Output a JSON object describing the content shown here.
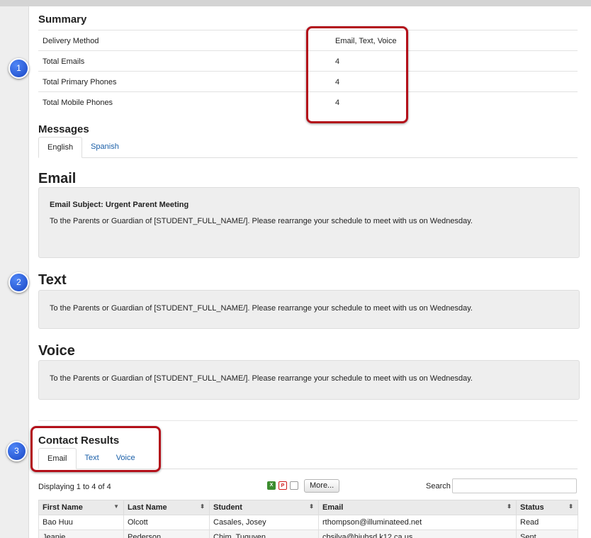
{
  "summary": {
    "title": "Summary",
    "rows": [
      {
        "label": "Delivery Method",
        "value": "Email, Text, Voice"
      },
      {
        "label": "Total Emails",
        "value": "4"
      },
      {
        "label": "Total Primary Phones",
        "value": "4"
      },
      {
        "label": "Total Mobile Phones",
        "value": "4"
      }
    ]
  },
  "messages": {
    "title": "Messages",
    "tabs": [
      "English",
      "Spanish"
    ],
    "email": {
      "heading": "Email",
      "subject": "Email Subject: Urgent Parent Meeting",
      "body": "To the Parents or Guardian of [STUDENT_FULL_NAME/].  Please rearrange your schedule to meet with us on Wednesday."
    },
    "text": {
      "heading": "Text",
      "body": "To the Parents or Guardian of [STUDENT_FULL_NAME/]. Please rearrange your schedule to meet with us on Wednesday."
    },
    "voice": {
      "heading": "Voice",
      "body": "To the Parents or Guardian of [STUDENT_FULL_NAME/]. Please rearrange your schedule to meet with us on Wednesday."
    }
  },
  "contact_results": {
    "title": "Contact Results",
    "tabs": [
      "Email",
      "Text",
      "Voice"
    ],
    "displaying": "Displaying 1 to 4 of 4",
    "more_label": "More...",
    "search_label": "Search",
    "search_value": "",
    "columns": [
      "First Name",
      "Last Name",
      "Student",
      "Email",
      "Status"
    ],
    "rows": [
      [
        "Bao Huu",
        "Olcott",
        "Casales, Josey",
        "rthompson@illuminateed.net",
        "Read"
      ],
      [
        "Jeanie",
        "Pederson",
        "Chim, Tuquyen",
        "cbsilva@hiuhsd.k12.ca.us",
        "Sent"
      ]
    ]
  },
  "callouts": [
    "1",
    "2",
    "3"
  ],
  "icons": {
    "excel": "excel-export-icon",
    "pdf": "pdf-export-icon",
    "doc": "document-export-icon"
  },
  "colors": {
    "highlight": "#b3101a",
    "callout": "#2a5ad8",
    "link": "#1a5fa8"
  }
}
